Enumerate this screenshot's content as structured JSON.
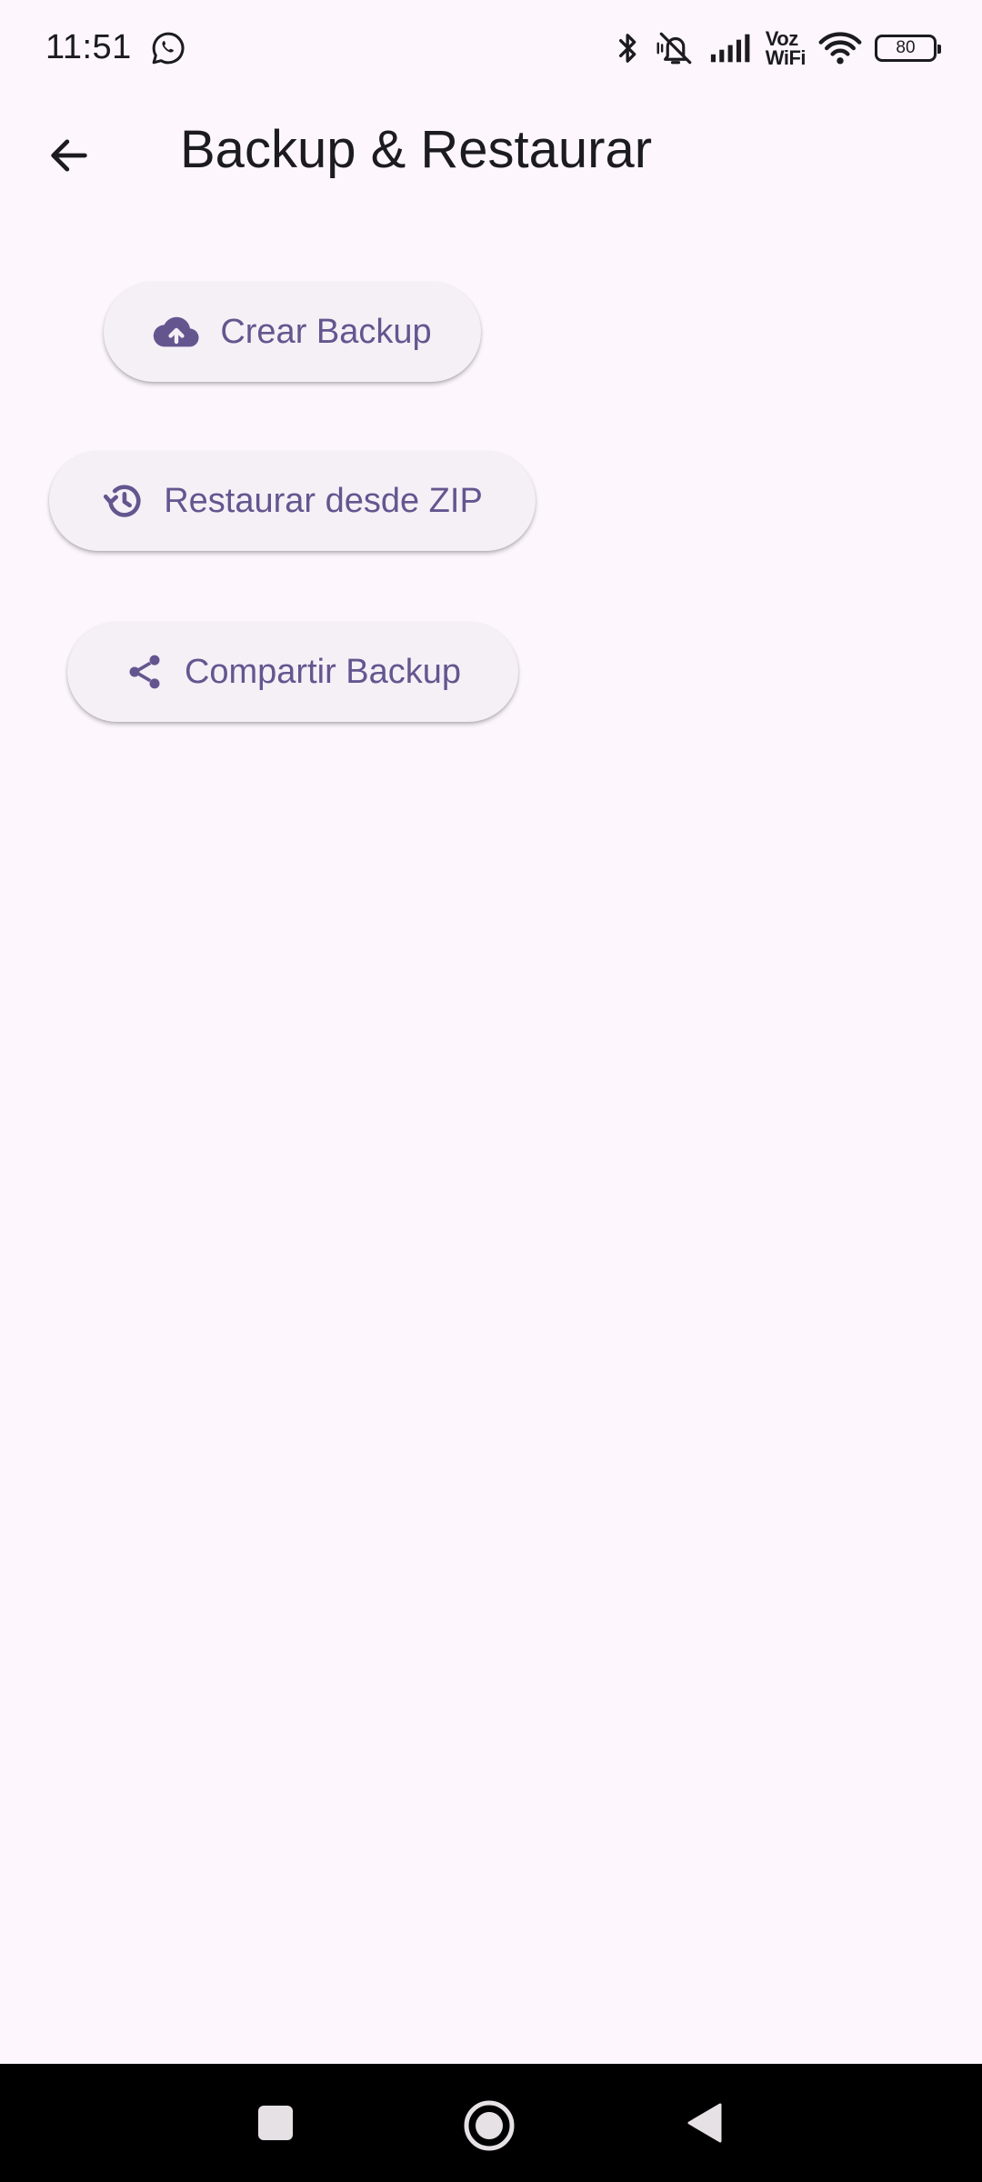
{
  "status_bar": {
    "time": "11:51",
    "voz_line1": "Voz",
    "voz_line2": "WiFi",
    "battery": "80"
  },
  "app_bar": {
    "title": "Backup & Restaurar"
  },
  "actions": {
    "create_label": "Crear Backup",
    "restore_label": "Restaurar desde ZIP",
    "share_label": "Compartir Backup"
  },
  "colors": {
    "background": "#fdf7fd",
    "button_bg": "#f5f0f6",
    "accent": "#65558f",
    "text": "#1c1b1f"
  },
  "icons": {
    "status": [
      "whatsapp-icon",
      "bluetooth-icon",
      "bell-off-icon",
      "signal-icon",
      "wifi-icon",
      "battery-icon"
    ],
    "app_bar": [
      "back-arrow-icon"
    ],
    "actions": [
      "cloud-upload-icon",
      "restore-history-icon",
      "share-icon"
    ],
    "nav": [
      "recents-square-icon",
      "home-circle-icon",
      "back-triangle-icon"
    ]
  }
}
